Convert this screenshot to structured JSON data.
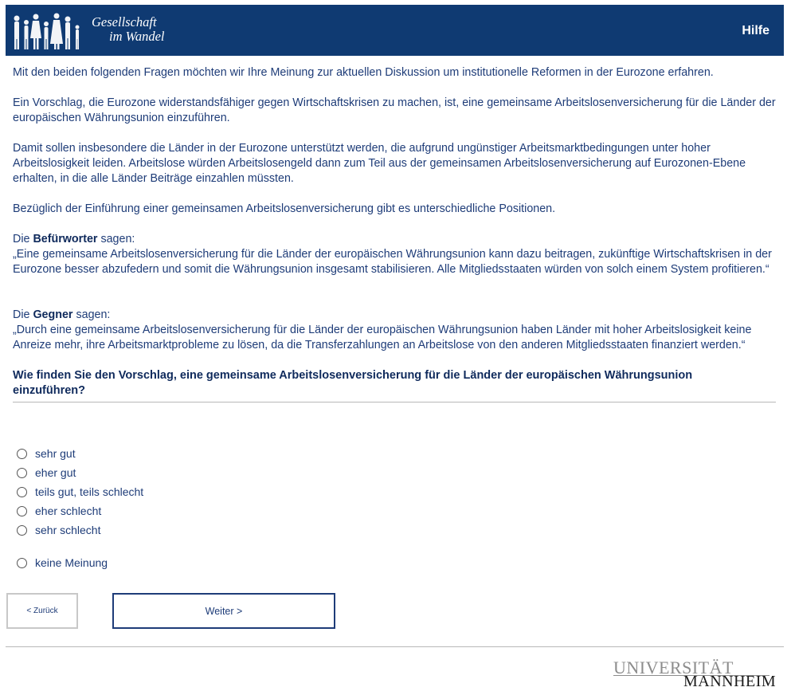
{
  "header": {
    "logo_line1": "Gesellschaft",
    "logo_line2": "im Wandel",
    "help_label": "Hilfe"
  },
  "intro": {
    "p1": "Mit den beiden folgenden Fragen möchten wir Ihre Meinung zur aktuellen Diskussion um institutionelle Reformen in der Eurozone erfahren.",
    "p2": "Ein Vorschlag, die Eurozone widerstandsfähiger gegen Wirtschaftskrisen zu machen, ist, eine gemeinsame Arbeitslosenversicherung für die Länder der europäischen Währungsunion einzuführen.",
    "p3": "Damit sollen insbesondere die Länder in der Eurozone unterstützt werden, die aufgrund ungünstiger Arbeitsmarktbedingungen unter hoher Arbeitslosigkeit leiden. Arbeitslose würden Arbeitslosengeld dann zum Teil aus der gemeinsamen Arbeitslosenversicherung auf Eurozonen-Ebene erhalten, in die alle Länder Beiträge einzahlen müssten.",
    "p4": "Bezüglich der Einführung einer gemeinsamen Arbeitslosenversicherung gibt es unterschiedliche Positionen.",
    "pro_prefix": "Die ",
    "pro_label": "Befürworter",
    "pro_suffix": " sagen:",
    "pro_quote": "„Eine gemeinsame Arbeitslosenversicherung für die Länder der europäischen Währungsunion kann dazu beitragen, zukünftige Wirtschaftskrisen in der Eurozone besser abzufedern und somit die Währungsunion insgesamt stabilisieren. Alle Mitgliedsstaaten würden von solch einem System profitieren.“",
    "con_prefix": "Die ",
    "con_label": "Gegner",
    "con_suffix": " sagen:",
    "con_quote": "„Durch eine gemeinsame Arbeitslosenversicherung für die Länder der europäischen Währungsunion haben Länder mit hoher Arbeitslosigkeit keine Anreize mehr, ihre Arbeitsmarktprobleme zu lösen, da die Transferzahlungen an Arbeitslose von den anderen Mitgliedsstaaten finanziert werden.“"
  },
  "question": "Wie finden Sie den Vorschlag, eine gemeinsame Arbeitslosenversicherung für die Länder der europäischen Währungsunion einzuführen?",
  "options": [
    "sehr gut",
    "eher gut",
    "teils gut, teils schlecht",
    "eher schlecht",
    "sehr schlecht",
    "keine Meinung"
  ],
  "buttons": {
    "back": "< Zurück",
    "next": "Weiter >"
  },
  "footer": {
    "uni_line1": "UNIVERSITÄT",
    "uni_line2": "MANNHEIM"
  }
}
